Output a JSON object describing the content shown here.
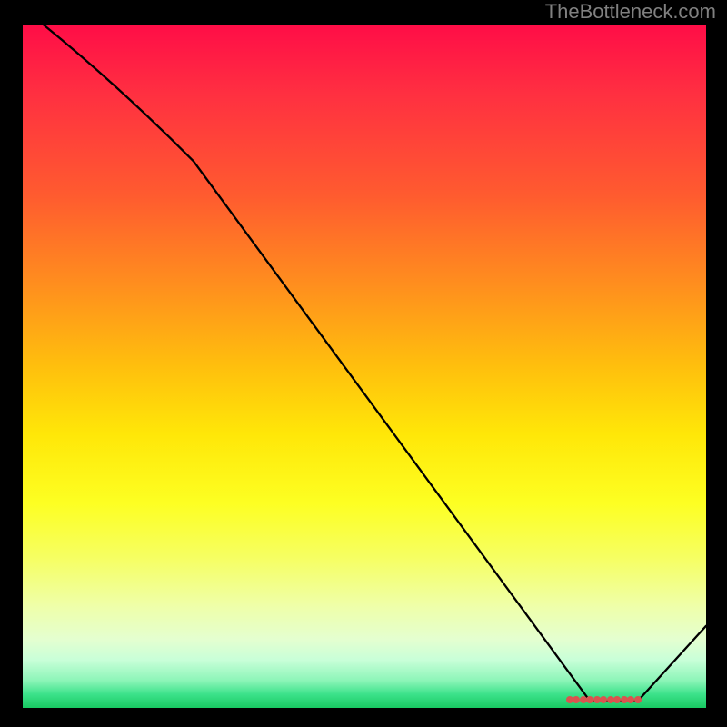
{
  "watermark": "TheBottleneck.com",
  "colors": {
    "frame": "#000000",
    "curve_stroke": "#000000",
    "marker_fill": "#d9544f",
    "watermark_text": "#808080"
  },
  "chart_data": {
    "type": "line",
    "title": "",
    "xlabel": "",
    "ylabel": "",
    "xlim": [
      0,
      100
    ],
    "ylim": [
      0,
      100
    ],
    "grid": false,
    "legend": false,
    "notes": "Gradient background transitions vertically from red (top) through orange, yellow, pale yellow, to green (bottom). Black curve descends from top-left, slight slope change near x≈25, reaches y≈0 around x≈85, flat near bottom until x≈90, then rises slightly toward right edge. A cluster of small red markers sits on the flat bottom segment roughly between x≈80 and x≈90.",
    "curve_points_xy": [
      [
        3,
        100
      ],
      [
        25,
        80
      ],
      [
        83,
        1
      ],
      [
        90,
        1
      ],
      [
        100,
        12
      ]
    ],
    "marker_cluster": {
      "y": 1.2,
      "x_values": [
        80,
        81,
        82,
        83,
        84,
        85,
        86,
        87,
        88,
        89,
        90
      ]
    }
  }
}
